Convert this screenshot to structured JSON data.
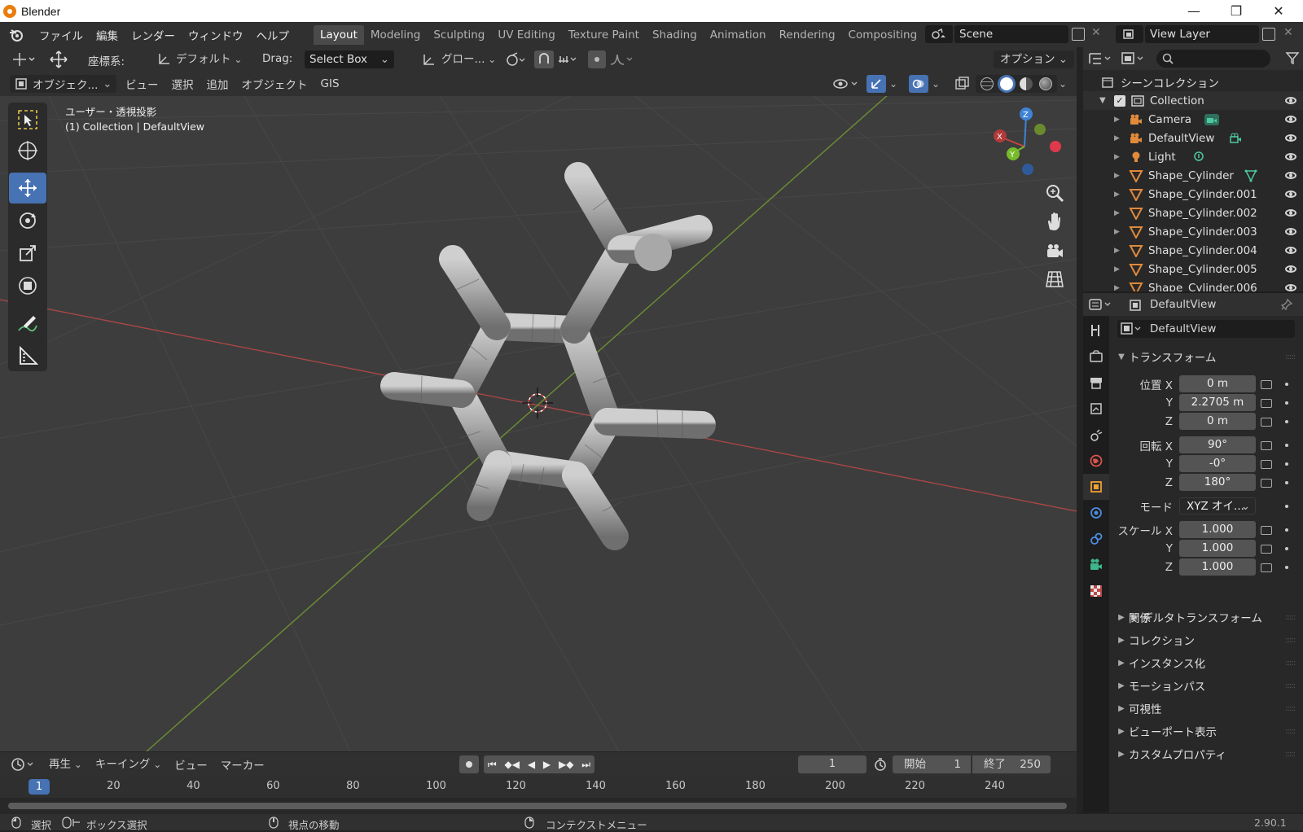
{
  "titlebar": {
    "app_title": "Blender"
  },
  "menu": {
    "items": [
      "ファイル",
      "編集",
      "レンダー",
      "ウィンドウ",
      "ヘルプ"
    ]
  },
  "workspaces": [
    "Layout",
    "Modeling",
    "Sculpting",
    "UV Editing",
    "Texture Paint",
    "Shading",
    "Animation",
    "Rendering",
    "Compositing"
  ],
  "scene": {
    "name": "Scene",
    "view_layer": "View Layer"
  },
  "toolheader": {
    "coord_label": "座標系:",
    "coord_value": "デフォルト",
    "drag_label": "Drag:",
    "drag_value": "Select Box",
    "transform_orientation": "グロー...",
    "options_label": "オプション"
  },
  "viewheader": {
    "mode": "オブジェク...",
    "menus": [
      "ビュー",
      "選択",
      "追加",
      "オブジェクト",
      "GIS"
    ]
  },
  "viewport": {
    "overlay_title": "ユーザー・透視投影",
    "overlay_subtitle": "(1) Collection | DefaultView",
    "gizmo_x": "X",
    "gizmo_y": "Y",
    "gizmo_z": "Z"
  },
  "outliner": {
    "root": "シーンコレクション",
    "collection": "Collection",
    "items": [
      {
        "name": "Camera",
        "icon": "camera-icon"
      },
      {
        "name": "DefaultView",
        "icon": "camera-icon"
      },
      {
        "name": "Light",
        "icon": "light-icon"
      },
      {
        "name": "Shape_Cylinder",
        "icon": "mesh-icon"
      },
      {
        "name": "Shape_Cylinder.001",
        "icon": "mesh-icon"
      },
      {
        "name": "Shape_Cylinder.002",
        "icon": "mesh-icon"
      },
      {
        "name": "Shape_Cylinder.003",
        "icon": "mesh-icon"
      },
      {
        "name": "Shape_Cylinder.004",
        "icon": "mesh-icon"
      },
      {
        "name": "Shape_Cylinder.005",
        "icon": "mesh-icon"
      },
      {
        "name": "Shape_Cylinder.006",
        "icon": "mesh-icon"
      }
    ]
  },
  "properties": {
    "header_object": "DefaultView",
    "object_name": "DefaultView",
    "transform_title": "トランスフォーム",
    "location_label": "位置 X",
    "rotation_label": "回転 X",
    "scale_label": "スケール X",
    "axis_y": "Y",
    "axis_z": "Z",
    "location": [
      "0 m",
      "2.2705 m",
      "0 m"
    ],
    "rotation": [
      "90°",
      "-0°",
      "180°"
    ],
    "mode_label": "モード",
    "mode_value": "XYZ オイ...",
    "scale": [
      "1.000",
      "1.000",
      "1.000"
    ],
    "delta_transform": "デルタトランスフォーム",
    "panels": [
      "関係",
      "コレクション",
      "インスタンス化",
      "モーションパス",
      "可視性",
      "ビューポート表示",
      "カスタムプロパティ"
    ]
  },
  "timeline": {
    "menus": [
      "再生",
      "キーイング",
      "ビュー",
      "マーカー"
    ],
    "current_frame": "1",
    "start_label": "開始",
    "start_value": "1",
    "end_label": "終了",
    "end_value": "250",
    "ruler": [
      "1",
      "20",
      "40",
      "60",
      "80",
      "100",
      "120",
      "140",
      "160",
      "180",
      "200",
      "220",
      "240"
    ]
  },
  "status": {
    "select": "選択",
    "box_select": "ボックス選択",
    "move_view": "視点の移動",
    "context_menu": "コンテクストメニュー",
    "version": "2.90.1"
  }
}
